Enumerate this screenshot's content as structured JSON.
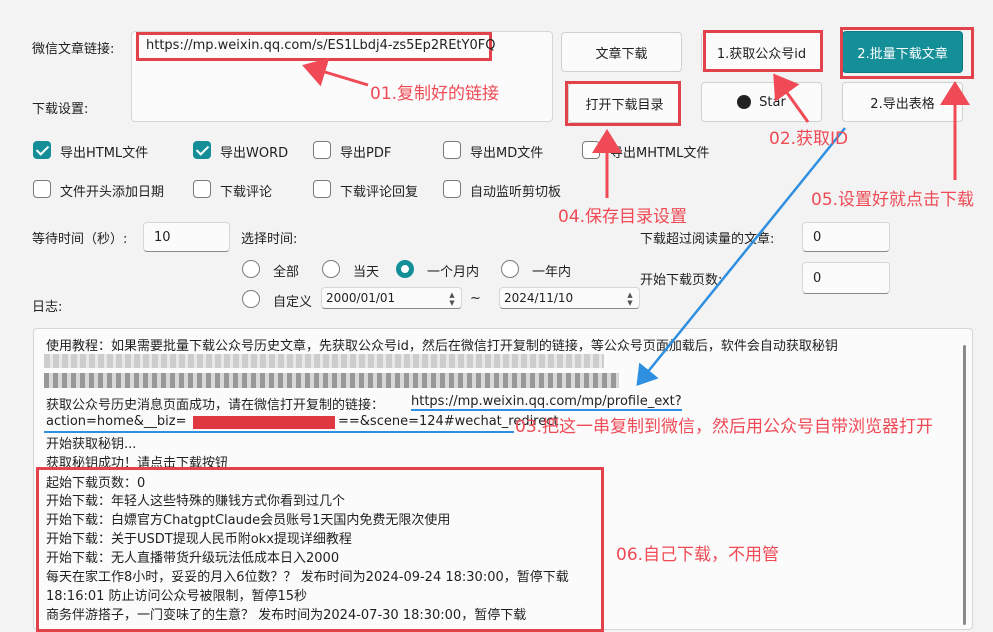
{
  "top": {
    "url_label": "微信文章链接:",
    "url_value": "https://mp.weixin.qq.com/s/ES1Lbdj4-zs5Ep2REtY0FQ",
    "download_settings_label": "下载设置:",
    "article_download_btn": "文章下载",
    "get_id_btn": "1.获取公众号id",
    "batch_download_btn": "2.批量下载文章",
    "open_dir_btn": "打开下载目录",
    "star_btn": "Star",
    "export_table_btn": "2.导出表格"
  },
  "options": [
    {
      "label": "导出HTML文件",
      "checked": true
    },
    {
      "label": "导出WORD",
      "checked": true
    },
    {
      "label": "导出PDF",
      "checked": false
    },
    {
      "label": "导出MD文件",
      "checked": false
    },
    {
      "label": "导出MHTML文件",
      "checked": false
    },
    {
      "label": "文件开头添加日期",
      "checked": false
    },
    {
      "label": "下载评论",
      "checked": false
    },
    {
      "label": "下载评论回复",
      "checked": false
    },
    {
      "label": "自动监听剪切板",
      "checked": false
    }
  ],
  "wait": {
    "label": "等待时间（秒）:",
    "value": "10"
  },
  "time_select": {
    "label": "选择时间:",
    "options": [
      "全部",
      "当天",
      "一个月内",
      "一年内",
      "自定义"
    ],
    "selected": "一个月内",
    "start_date": "2000/01/01",
    "tilde": "~",
    "end_date": "2024/11/10"
  },
  "read_count": {
    "label": "下载超过阅读量的文章:",
    "value": "0"
  },
  "start_page": {
    "label": "开始下载页数:",
    "value": "0"
  },
  "log_label": "日志:",
  "log_lines": [
    "使用教程：如果需要批量下载公众号历史文章，先获取公众号id，然后在微信打开复制的链接，等公众号页面加载后，软件会自动获取秘钥",
    "获取公众号历史消息页面成功，请在微信打开复制的链接：",
    "https://mp.weixin.qq.com/mp/profile_ext?",
    "action=home&__biz=",
    "==&scene=124#wechat_redirect",
    "开始获取秘钥...",
    "获取秘钥成功！请点击下载按钮",
    "起始下载页数：0",
    "开始下载：年轻人这些特殊的赚钱方式你看到过几个",
    "开始下载：白嫖官方ChatgptClaude会员账号1天国内免费无限次使用",
    "开始下载：关于USDT提现人民币附okx提现详细教程",
    "开始下载：无人直播带货升级玩法低成本日入2000",
    "每天在家工作8小时，妥妥的月入6位数？？ 发布时间为2024-09-24 18:30:00，暂停下载",
    "18:16:01 防止访问公众号被限制，暂停15秒",
    "商务伴游搭子，一门变味了的生意？ 发布时间为2024-07-30 18:30:00，暂停下载"
  ],
  "annotations": {
    "a1": "01.复制好的链接",
    "a2": "02.获取ID",
    "a3": "03.把这一串复制到微信，然后用公众号自带浏览器打开",
    "a4": "04.保存目录设置",
    "a5": "05.设置好就点击下载",
    "a6": "06.自己下载，不用管"
  },
  "colors": {
    "accent": "#148f98",
    "annotation": "#ef4a55",
    "link_underline": "#2f8fe0"
  }
}
